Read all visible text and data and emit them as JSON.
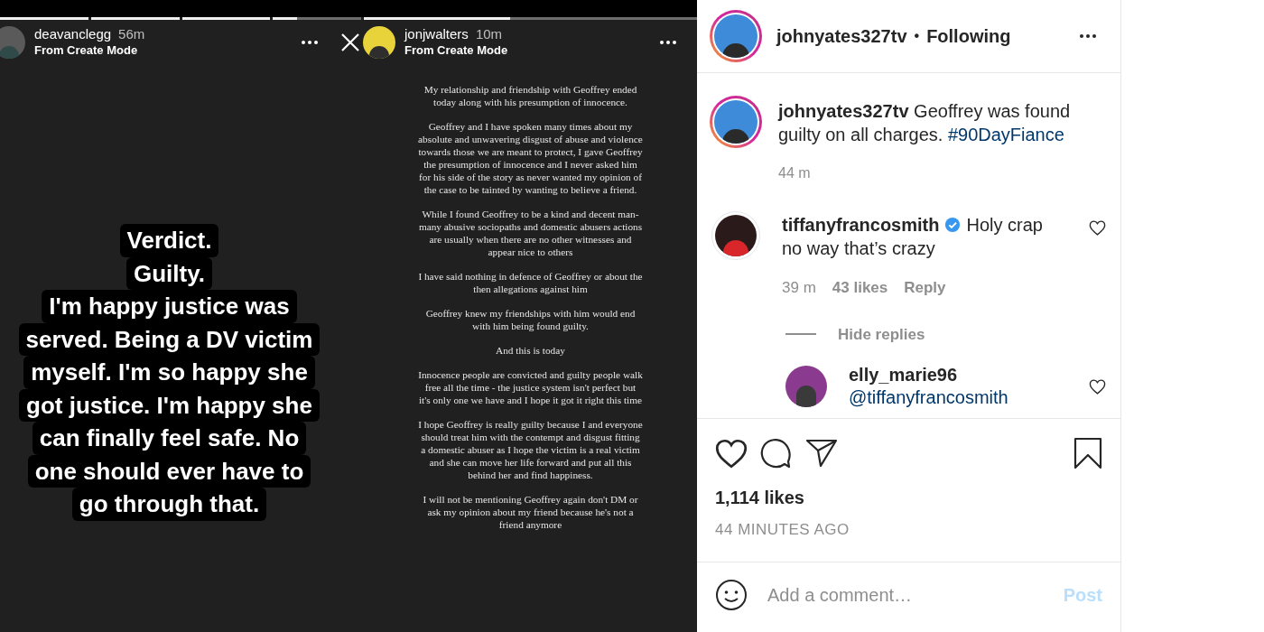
{
  "stories": [
    {
      "username": "deavanclegg",
      "time": "56m",
      "subtitle": "From Create Mode",
      "progress": [
        {
          "level": 1
        },
        {
          "level": 1
        },
        {
          "level": 1
        },
        {
          "level": 0.27
        }
      ],
      "close": false,
      "caption_lines": [
        "Verdict.",
        "Guilty.",
        "I'm happy justice was",
        "served. Being a DV victim",
        "myself. I'm so happy she",
        "got justice. I'm happy she",
        "can finally feel safe. No",
        "one should ever have to",
        "go through that."
      ]
    },
    {
      "username": "jonjwalters",
      "time": "10m",
      "subtitle": "From Create Mode",
      "progress": [
        {
          "level": 0.44
        }
      ],
      "close": true,
      "paragraphs": [
        "My relationship and friendship with Geoffrey ended today along with his presumption of innocence.",
        "Geoffrey and I have spoken many times about my absolute and unwavering disgust of abuse and violence towards those we are meant to protect, I gave Geoffrey the presumption of innocence and I never asked him for his side of the story as never wanted my opinion of the case to be tainted by wanting to believe a friend.",
        "While I found Geoffrey to be a kind and decent man- many abusive sociopaths and domestic abusers actions are usually when there are no other witnesses and appear nice to others",
        "I have said nothing in defence of Geoffrey or about the then allegations against him",
        "Geoffrey knew my friendships with him would end with him being found guilty.",
        "And this is today",
        "Innocence people are convicted and guilty people walk free all the time - the justice system isn't perfect but it's only one we have and I hope it got it right this time",
        "I hope Geoffrey is really guilty because I and everyone should treat him with the contempt and disgust fitting a domestic abuser  as I hope the victim is a real victim and she can move her life forward and put all this behind her and find happiness.",
        "I will not be mentioning Geoffrey again don't DM or ask my opinion about my friend because he's not a friend anymore"
      ]
    }
  ],
  "post": {
    "username": "johnyates327tv",
    "separator": "•",
    "follow_status": "Following",
    "caption": {
      "username": "johnyates327tv",
      "text": "Geoffrey was found guilty on all charges.",
      "hashtag": "#90DayFiance",
      "time": "44 m"
    },
    "comments": [
      {
        "username": "tiffanyfrancosmith",
        "verified": true,
        "text": "Holy crap no way that’s crazy",
        "time": "39 m",
        "likes": "43 likes",
        "reply": "Reply",
        "toggle": "Hide replies",
        "replies": [
          {
            "username": "elly_marie96",
            "mention": "@tiffanyfrancosmith"
          }
        ]
      }
    ],
    "likes": "1,114 likes",
    "age": "44 MINUTES AGO",
    "comment_placeholder": "Add a comment…",
    "post_button": "Post",
    "post_enabled": false
  }
}
